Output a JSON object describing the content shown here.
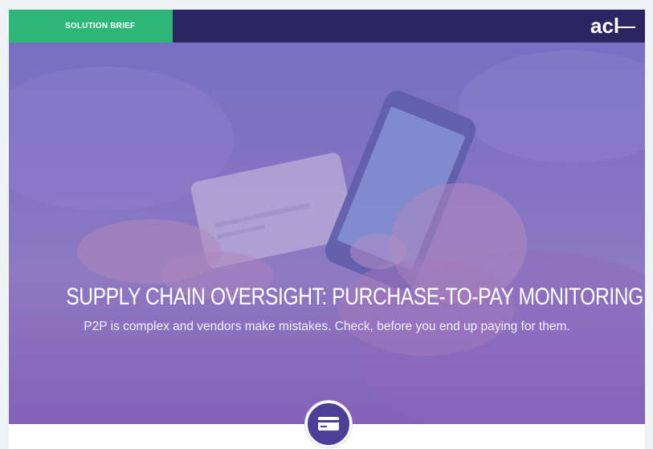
{
  "header": {
    "tag_label": "SOLUTION BRIEF",
    "logo_text": "acl"
  },
  "hero": {
    "title": "SUPPLY CHAIN OVERSIGHT: PURCHASE-TO-PAY MONITORING",
    "subtitle": "P2P is complex and vendors make mistakes. Check, before you end up paying for them."
  },
  "colors": {
    "tag_green": "#2eb679",
    "header_navy": "#2c2562",
    "hero_purple": "#8a7dc8",
    "badge_purple": "#4d3f97"
  },
  "icons": [
    "credit-card-icon"
  ]
}
